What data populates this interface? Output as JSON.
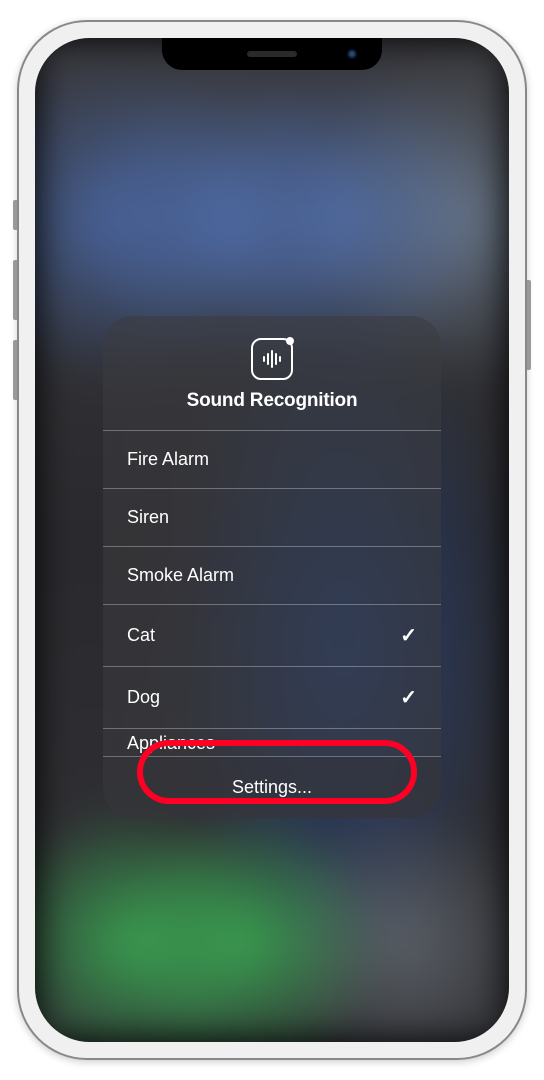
{
  "panel": {
    "title": "Sound Recognition",
    "settings_label": "Settings...",
    "items": [
      {
        "label": "Fire Alarm",
        "checked": false
      },
      {
        "label": "Siren",
        "checked": false
      },
      {
        "label": "Smoke Alarm",
        "checked": false
      },
      {
        "label": "Cat",
        "checked": true
      },
      {
        "label": "Dog",
        "checked": true
      }
    ],
    "partial_item": "Appliances"
  }
}
